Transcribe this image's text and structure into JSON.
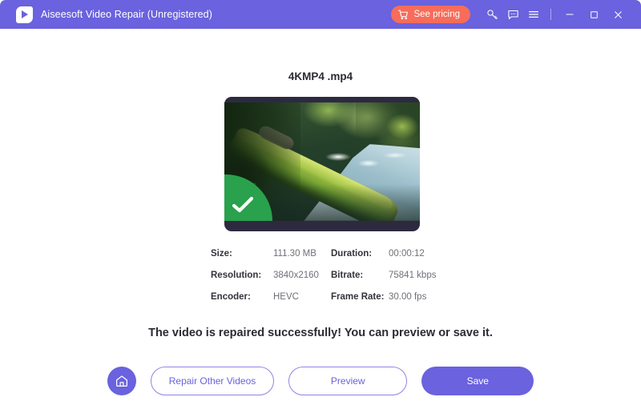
{
  "window": {
    "app_title": "Aiseesoft Video Repair (Unregistered)",
    "logo_icon": "play-logo-icon",
    "titlebar_bg": "#6a62de"
  },
  "titlebar": {
    "pricing_button": {
      "label": "See pricing",
      "icon": "shopping-cart-icon",
      "color": "#f76c5a"
    },
    "icons": [
      {
        "name": "key-icon",
        "title": "Register"
      },
      {
        "name": "feedback-icon",
        "title": "Feedback"
      },
      {
        "name": "menu-icon",
        "title": "Menu"
      }
    ],
    "controls": [
      {
        "name": "minimize-icon"
      },
      {
        "name": "maximize-icon"
      },
      {
        "name": "close-icon"
      }
    ]
  },
  "main": {
    "file_title": "4KMP4 .mp4",
    "thumbnail": {
      "alt": "forest stream with mossy fallen log",
      "badge_icon": "check-mark-icon",
      "badge_color": "#2aa14c"
    },
    "metadata": [
      {
        "label": "Size:",
        "value": "111.30 MB"
      },
      {
        "label": "Duration:",
        "value": "00:00:12"
      },
      {
        "label": "Resolution:",
        "value": "3840x2160"
      },
      {
        "label": "Bitrate:",
        "value": "75841 kbps"
      },
      {
        "label": "Encoder:",
        "value": "HEVC"
      },
      {
        "label": "Frame Rate:",
        "value": "30.00 fps"
      }
    ],
    "status_message": "The video is repaired successfully! You can preview or save it.",
    "actions": {
      "home_icon": "home-icon",
      "repair_other": "Repair Other Videos",
      "preview": "Preview",
      "save": "Save",
      "accent": "#6a62de"
    }
  }
}
